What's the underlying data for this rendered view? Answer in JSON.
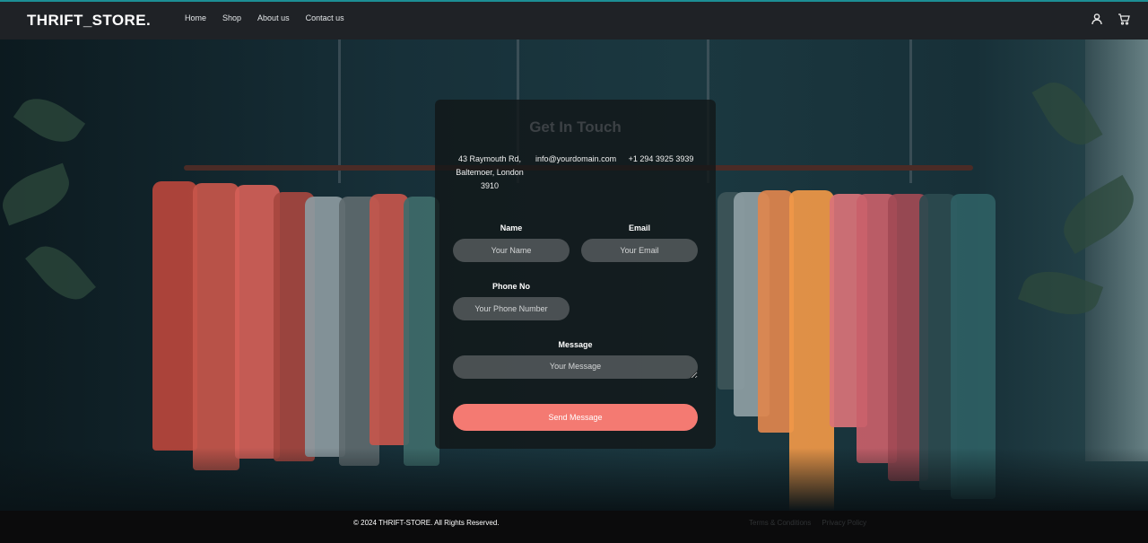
{
  "header": {
    "brand": "THRIFT_STORE.",
    "nav": [
      "Home",
      "Shop",
      "About us",
      "Contact us"
    ],
    "icons": [
      "user-icon",
      "cart-icon"
    ]
  },
  "contact": {
    "title": "Get In Touch",
    "address": "43 Raymouth Rd, Baltemoer, London 3910",
    "email": "info@yourdomain.com",
    "phone": "+1 294 3925 3939",
    "form": {
      "name_label": "Name",
      "name_placeholder": "Your Name",
      "email_label": "Email",
      "email_placeholder": "Your Email",
      "phone_label": "Phone No",
      "phone_placeholder": "Your Phone Number",
      "message_label": "Message",
      "message_placeholder": "Your Message",
      "submit_label": "Send Message"
    }
  },
  "footer": {
    "copyright": "© 2024 THRIFT-STORE. All Rights Reserved.",
    "links": [
      "Terms & Conditions",
      "Privacy Policy"
    ]
  },
  "colors": {
    "accent": "#f47a72",
    "header_bg": "#1f2226",
    "header_border": "#1c8f95",
    "footer_bg": "#0b0b0c"
  }
}
